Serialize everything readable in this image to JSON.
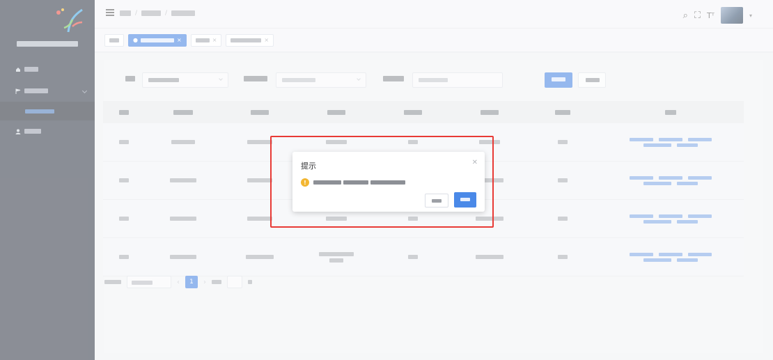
{
  "sidebar": {
    "brand": "",
    "subtitle": "",
    "items": [
      {
        "label": "",
        "icon": "home-icon"
      },
      {
        "label": "",
        "icon": "flag-icon",
        "expanded": true,
        "submenu": [
          {
            "label": "",
            "active": true
          }
        ]
      },
      {
        "label": "",
        "icon": "user-icon"
      }
    ]
  },
  "topbar": {
    "breadcrumb": [
      "",
      "",
      ""
    ],
    "icons": [
      "search-icon",
      "fullscreen-icon",
      "font-size-icon"
    ]
  },
  "tags": [
    {
      "label": "",
      "active": false
    },
    {
      "label": "",
      "active": true
    },
    {
      "label": "",
      "active": false
    },
    {
      "label": "",
      "active": false
    }
  ],
  "filters": {
    "field1": {
      "label": "",
      "value": ""
    },
    "field2": {
      "label": "",
      "placeholder": ""
    },
    "field3": {
      "label": "",
      "placeholder": ""
    },
    "search_label": "",
    "reset_label": ""
  },
  "table": {
    "headers": [
      "",
      "",
      "",
      "",
      "",
      "",
      "",
      ""
    ],
    "rows": [
      {
        "level": "",
        "competition": "",
        "code": "",
        "name": "",
        "mode": "",
        "school": "",
        "status": ""
      },
      {
        "level": "",
        "competition": "",
        "code": "",
        "name": "",
        "mode": "",
        "school": "",
        "status": ""
      },
      {
        "level": "",
        "competition": "",
        "code": "",
        "name": "",
        "mode": "",
        "school": "",
        "status": ""
      },
      {
        "level": "",
        "competition": "",
        "code": "",
        "name": "",
        "mode": "",
        "school": "",
        "status": ""
      }
    ]
  },
  "pagination": {
    "total_text": "",
    "page_size": "",
    "current_page": "1",
    "goto_label": ""
  },
  "dialog": {
    "title": "提示",
    "message": "",
    "cancel_label": "",
    "confirm_label": ""
  },
  "colors": {
    "primary": "#3f7fe0",
    "sidebar_bg": "#2b3240",
    "warning": "#f2b632",
    "highlight": "#e83a35"
  }
}
